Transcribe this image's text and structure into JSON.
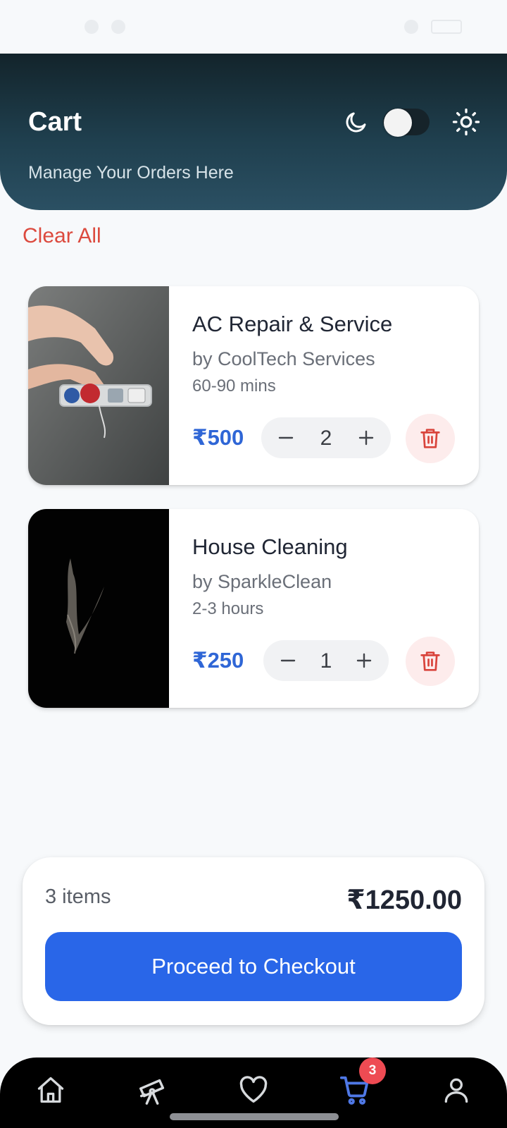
{
  "header": {
    "title": "Cart",
    "subtitle": "Manage Your Orders Here"
  },
  "theme_toggle": {
    "dark_mode": false
  },
  "clear_all_label": "Clear All",
  "cart_items": [
    {
      "title": "AC Repair & Service",
      "provider": "by CoolTech Services",
      "duration": "60-90 mins",
      "price": "₹500",
      "quantity": "2"
    },
    {
      "title": "House Cleaning",
      "provider": "by SparkleClean",
      "duration": "2-3 hours",
      "price": "₹250",
      "quantity": "1"
    }
  ],
  "summary": {
    "item_count": "3 items",
    "total": "₹1250.00",
    "checkout_label": "Proceed to Checkout"
  },
  "nav": {
    "items": [
      "home-icon",
      "telescope-icon",
      "heart-icon",
      "cart-icon",
      "profile-icon"
    ],
    "active": "cart-icon",
    "cart_badge": "3"
  },
  "colors": {
    "accent": "#2966e8",
    "danger": "#dc4a3e",
    "header_top": "#13242b",
    "header_bottom": "#2b5063",
    "badge": "#ee4b53"
  }
}
